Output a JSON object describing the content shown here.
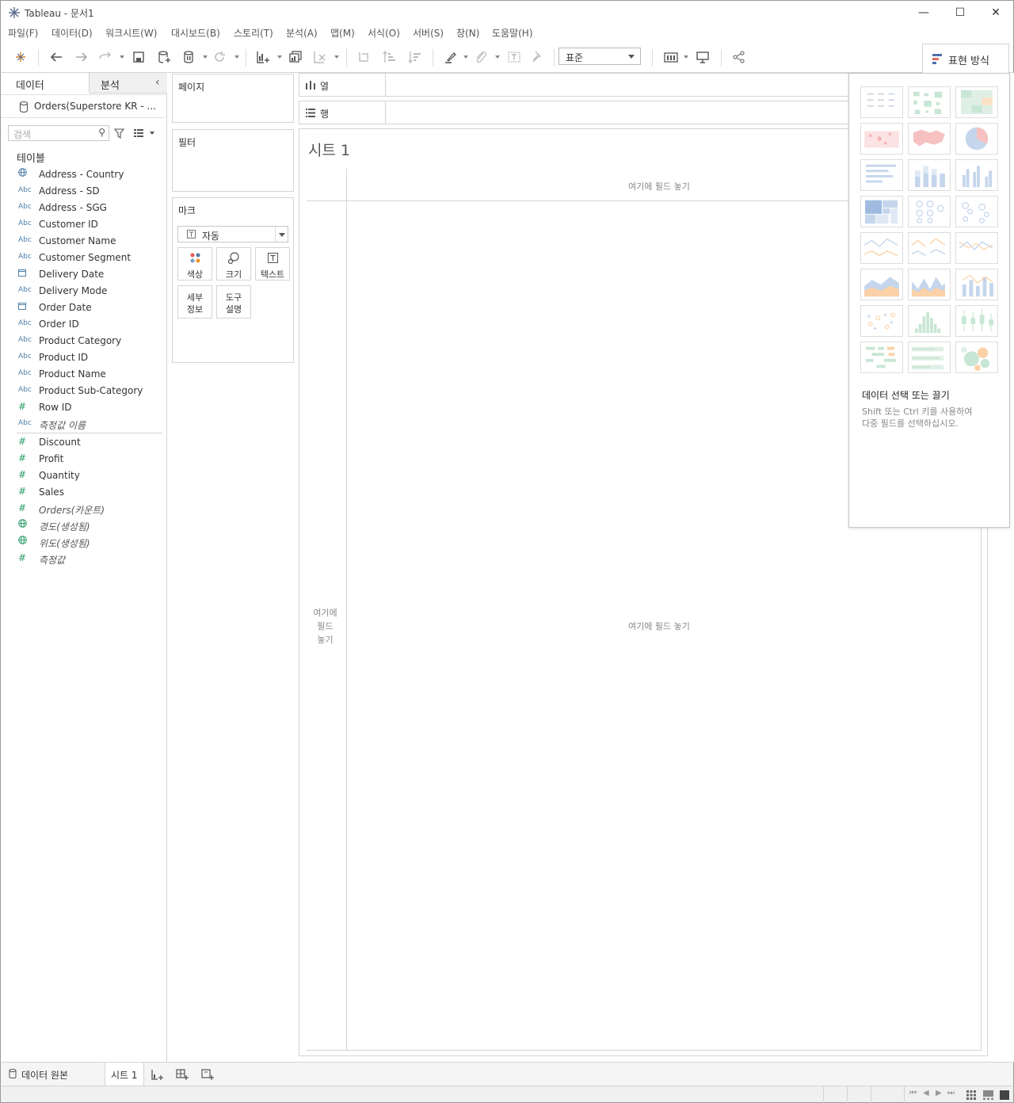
{
  "window": {
    "title": "Tableau - 문서1"
  },
  "menu": [
    "파일(F)",
    "데이터(D)",
    "워크시트(W)",
    "대시보드(B)",
    "스토리(T)",
    "분석(A)",
    "맵(M)",
    "서식(O)",
    "서버(S)",
    "창(N)",
    "도움말(H)"
  ],
  "toolbar": {
    "fit_select": "표준",
    "showme_label": "표현 방식"
  },
  "left_panel": {
    "tab_data": "데이터",
    "tab_analysis": "분석",
    "datasource": "Orders(Superstore KR - ...",
    "search_placeholder": "검색",
    "tables_label": "테이블",
    "dimensions": [
      {
        "type": "geo",
        "name": "Address - Country"
      },
      {
        "type": "abc",
        "name": "Address - SD"
      },
      {
        "type": "abc",
        "name": "Address - SGG"
      },
      {
        "type": "abc",
        "name": "Customer ID"
      },
      {
        "type": "abc",
        "name": "Customer Name"
      },
      {
        "type": "abc",
        "name": "Customer Segment"
      },
      {
        "type": "date",
        "name": "Delivery Date"
      },
      {
        "type": "abc",
        "name": "Delivery Mode"
      },
      {
        "type": "date",
        "name": "Order Date"
      },
      {
        "type": "abc",
        "name": "Order ID"
      },
      {
        "type": "abc",
        "name": "Product Category"
      },
      {
        "type": "abc",
        "name": "Product ID"
      },
      {
        "type": "abc",
        "name": "Product Name"
      },
      {
        "type": "abc",
        "name": "Product Sub-Category"
      },
      {
        "type": "num",
        "name": "Row ID"
      },
      {
        "type": "abc",
        "name": "측정값 이름",
        "italic": true
      }
    ],
    "measures": [
      {
        "type": "num",
        "name": "Discount"
      },
      {
        "type": "num",
        "name": "Profit"
      },
      {
        "type": "num",
        "name": "Quantity"
      },
      {
        "type": "num",
        "name": "Sales"
      },
      {
        "type": "num",
        "name": "Orders(카운트)",
        "italic": true
      },
      {
        "type": "geo",
        "name": "경도(생성됨)",
        "italic": true
      },
      {
        "type": "geo",
        "name": "위도(생성됨)",
        "italic": true
      },
      {
        "type": "num",
        "name": "측정값",
        "italic": true
      }
    ],
    "abc_label": "Abc"
  },
  "cards": {
    "pages": "페이지",
    "filters": "필터",
    "marks": "마크",
    "mark_type": "자동",
    "mark_buttons": [
      "색상",
      "크기",
      "텍스트"
    ],
    "mark_buttons2": [
      "세부\n정보",
      "도구\n설명"
    ],
    "detail_l1": "세부",
    "detail_l2": "정보",
    "tooltip_l1": "도구",
    "tooltip_l2": "설명"
  },
  "shelves": {
    "columns": "열",
    "rows": "행"
  },
  "sheet": {
    "title": "시트 1",
    "drop_top": "여기에 필드 놓기",
    "drop_center": "여기에 필드 놓기",
    "drop_left_1": "여기에",
    "drop_left_2": "필드",
    "drop_left_3": "놓기"
  },
  "showme": {
    "heading": "데이터 선택 또는 끌기",
    "hint_1": "Shift 또는 Ctrl 키를 사용하여",
    "hint_2": "다중 필드를 선택하십시오."
  },
  "bottom": {
    "datasource_tab": "데이터 원본",
    "sheet_tab": "시트 1"
  },
  "colors": {
    "accent_blue": "#4f7fa8",
    "measure_green": "#2d9e6a",
    "border": "#d4d4d4"
  }
}
